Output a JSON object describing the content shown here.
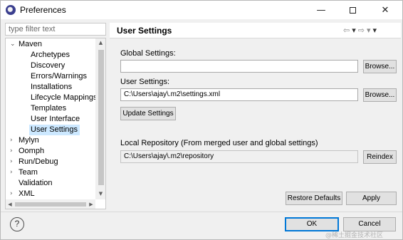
{
  "window": {
    "title": "Preferences",
    "minimize": "—",
    "close": "✕"
  },
  "filter": {
    "placeholder": "type filter text"
  },
  "tree": {
    "items": [
      {
        "label": "Maven",
        "expanded": true
      },
      {
        "label": "Archetypes"
      },
      {
        "label": "Discovery"
      },
      {
        "label": "Errors/Warnings"
      },
      {
        "label": "Installations"
      },
      {
        "label": "Lifecycle Mappings"
      },
      {
        "label": "Templates"
      },
      {
        "label": "User Interface"
      },
      {
        "label": "User Settings",
        "selected": true
      },
      {
        "label": "Mylyn"
      },
      {
        "label": "Oomph"
      },
      {
        "label": "Run/Debug"
      },
      {
        "label": "Team"
      },
      {
        "label": "Validation"
      },
      {
        "label": "XML"
      }
    ],
    "expanded_glyph": "⌄",
    "collapsed_glyph": "›"
  },
  "page": {
    "title": "User Settings",
    "nav": {
      "back": "⇦",
      "back_menu": "▾",
      "forward": "⇨",
      "forward_menu": "▾",
      "view_menu": "▾"
    }
  },
  "settings": {
    "global_label": "Global Settings:",
    "global_value": "",
    "user_label": "User Settings:",
    "user_value": "C:\\Users\\ajay\\.m2\\settings.xml",
    "browse_label": "Browse...",
    "update_label": "Update Settings",
    "local_repo_label": "Local Repository (From merged user and global settings)",
    "local_repo_value": "C:\\Users\\ajay\\.m2\\repository",
    "reindex_label": "Reindex",
    "restore_label": "Restore Defaults",
    "apply_label": "Apply"
  },
  "footer": {
    "help": "?",
    "ok_label": "OK",
    "cancel_label": "Cancel"
  },
  "watermark": "@稀土掘金技术社区",
  "colors": {
    "selection": "#cce8ff",
    "default_button_border": "#0078d7"
  }
}
